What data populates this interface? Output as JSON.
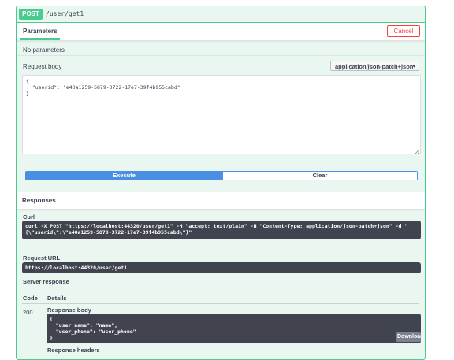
{
  "operation": {
    "method": "POST",
    "path": "/user/get1"
  },
  "parameters": {
    "tab_label": "Parameters",
    "cancel_label": "Cancel",
    "no_params_text": "No parameters"
  },
  "request_body": {
    "label": "Request body",
    "content_type": "application/json-patch+json",
    "value": "{\n  \"userid\": \"e40a1259-5879-3722-17e7-39f4b955cabd\"\n}"
  },
  "actions": {
    "execute_label": "Execute",
    "clear_label": "Clear"
  },
  "responses": {
    "title": "Responses",
    "curl_label": "Curl",
    "curl_text": "curl -X POST \"https://localhost:44320/user/get1\" -H \"accept: text/plain\" -H \"Content-Type: application/json-patch+json\" -d \"\n{\\\"userid\\\":\\\"e40a1259-5879-3722-17e7-39f4b955cabd\\\"}\"",
    "request_url_label": "Request URL",
    "request_url": "https://localhost:44320/user/get1",
    "server_response_label": "Server response",
    "code_header": "Code",
    "details_header": "Details",
    "code": "200",
    "response_body_label": "Response body",
    "response_body": "{\n  \"user_name\": \"name\",\n  \"user_phone\": \"user_phone\"\n}",
    "download_label": "Download",
    "response_headers_label": "Response headers"
  },
  "colors": {
    "post_green": "#49cc90",
    "execute_blue": "#4990e2",
    "cancel_red": "#f93e3e",
    "code_dark": "#41444e"
  }
}
